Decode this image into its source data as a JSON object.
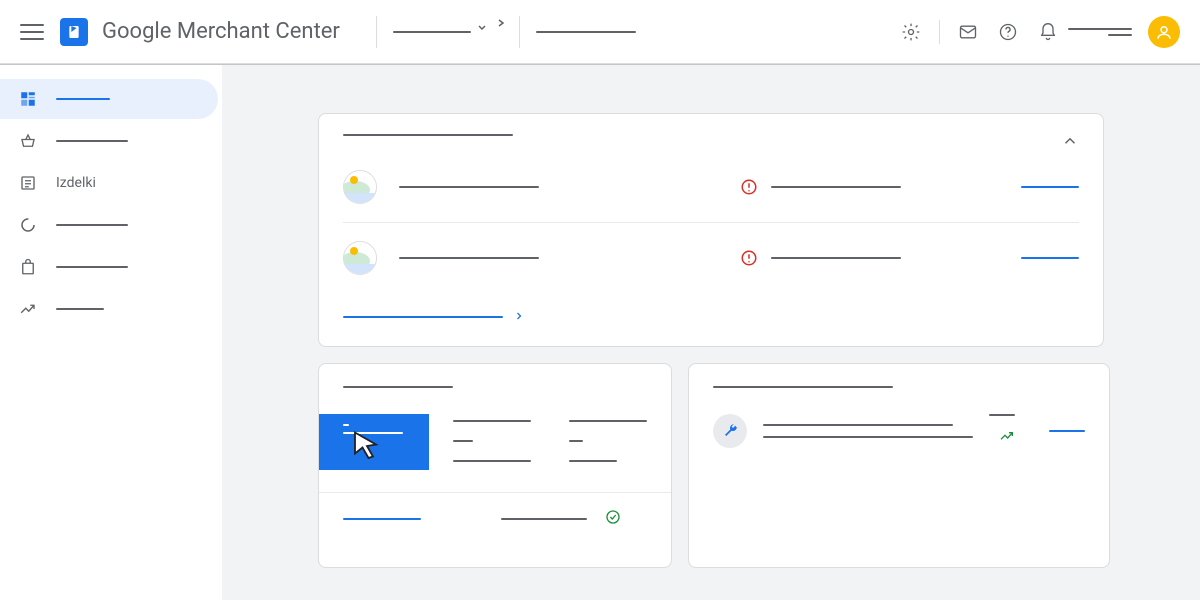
{
  "header": {
    "app_title": "Google Merchant Center",
    "account_selector_placeholder": "",
    "search_placeholder": "",
    "icons": {
      "settings": "settings",
      "mail": "mail",
      "help": "help",
      "notifications": "notifications"
    },
    "account_name_placeholder": "",
    "account_id_placeholder": ""
  },
  "sidebar": {
    "items": [
      {
        "id": "overview",
        "label": "",
        "icon": "dashboard",
        "active": true
      },
      {
        "id": "basket",
        "label": "",
        "icon": "basket",
        "active": false
      },
      {
        "id": "products",
        "label": "Izdelki",
        "icon": "list",
        "active": false
      },
      {
        "id": "performance",
        "label": "",
        "icon": "donut",
        "active": false
      },
      {
        "id": "shopping",
        "label": "",
        "icon": "bag",
        "active": false
      },
      {
        "id": "growth",
        "label": "",
        "icon": "trend",
        "active": false
      }
    ]
  },
  "main": {
    "pending_card": {
      "title": "",
      "rows": [
        {
          "name": "",
          "status_text": "",
          "status": "error",
          "action_label": ""
        },
        {
          "name": "",
          "status_text": "",
          "status": "error",
          "action_label": ""
        }
      ],
      "footer_link_label": ""
    },
    "overview_card": {
      "title": "",
      "active_tab_label": "",
      "cols": [
        {
          "head": "",
          "value": ""
        },
        {
          "head": "",
          "value": ""
        }
      ],
      "footer_left_link": "",
      "footer_mid": "",
      "footer_status": "ok"
    },
    "insight_card": {
      "title": "",
      "item_line1": "",
      "item_line2": "",
      "tag": "",
      "action_label": ""
    }
  }
}
